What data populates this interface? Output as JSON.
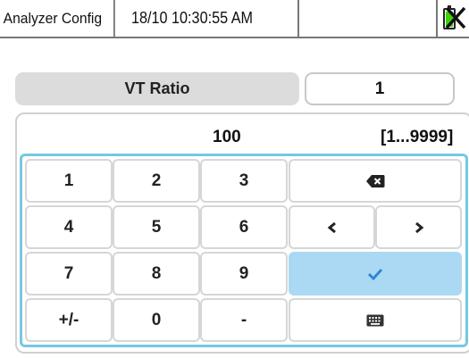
{
  "status_bar": {
    "title": "Analyzer Config",
    "datetime": "18/10 10:30:55 AM",
    "battery_icon": "battery-full-icon",
    "battery_color": "#39d400",
    "close_icon": "close-icon"
  },
  "parameter": {
    "label": "VT Ratio",
    "value": "1"
  },
  "entry": {
    "value": "100",
    "range": "[1...9999]"
  },
  "keypad": {
    "keys": {
      "k1": "1",
      "k2": "2",
      "k3": "3",
      "k4": "4",
      "k5": "5",
      "k6": "6",
      "k7": "7",
      "k8": "8",
      "k9": "9",
      "plusminus": "+/-",
      "k0": "0",
      "decimal": "-"
    },
    "icons": {
      "backspace": "backspace-icon",
      "left": "arrow-left-icon",
      "right": "arrow-right-icon",
      "confirm": "checkmark-icon",
      "keyboard": "keyboard-icon"
    },
    "border_color": "#76c8de",
    "enter_color": "#abd9f3"
  }
}
